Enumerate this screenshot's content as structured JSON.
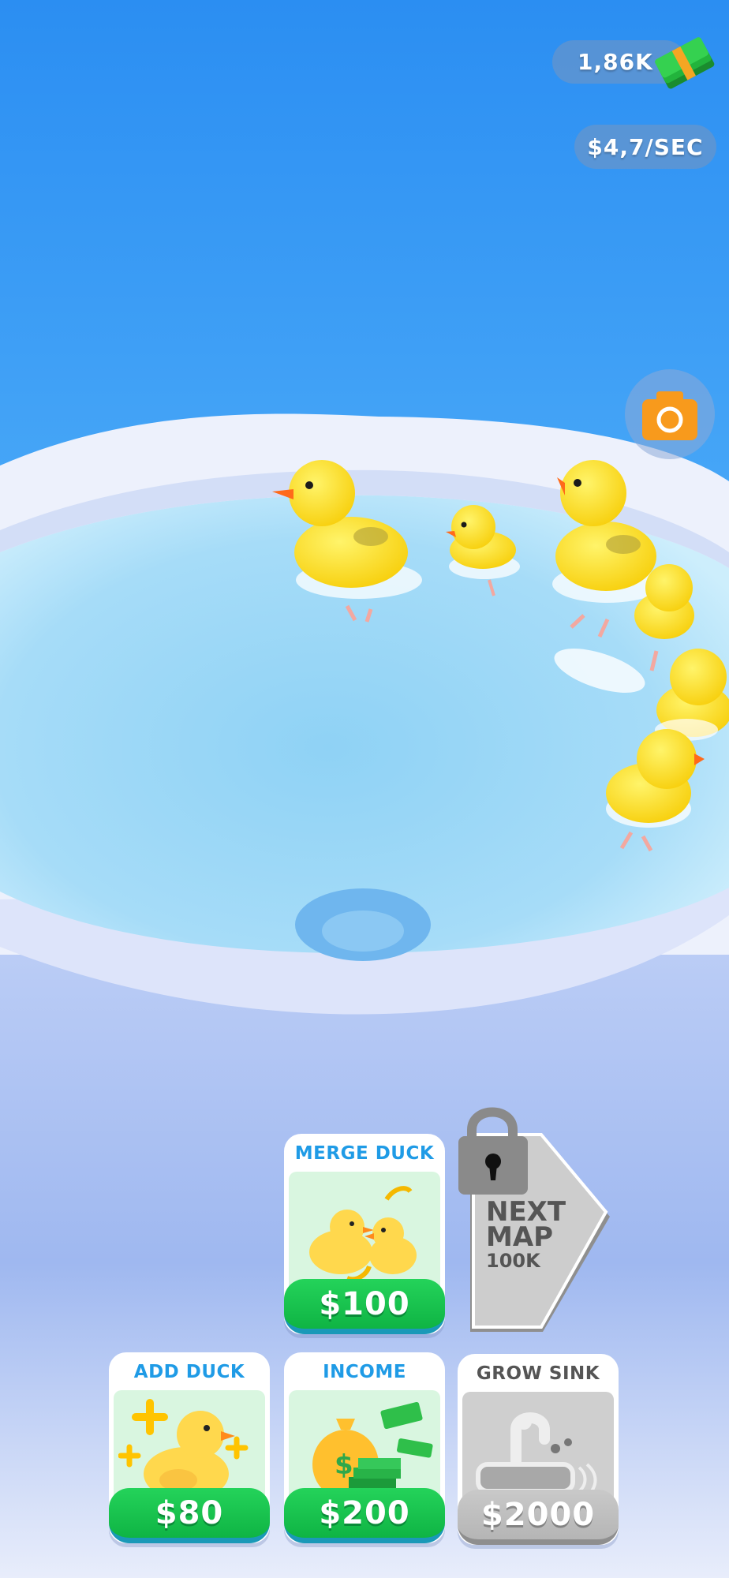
{
  "hud": {
    "money": "1,86K",
    "income_rate": "$4,7/SEC",
    "money_icon": "cash-stack-icon",
    "camera_icon": "camera-icon"
  },
  "upgrades": {
    "merge_duck": {
      "title": "MERGE DUCK",
      "price": "$100"
    },
    "add_duck": {
      "title": "ADD DUCK",
      "price": "$80"
    },
    "income": {
      "title": "INCOME",
      "price": "$200"
    },
    "grow_sink": {
      "title": "GROW SINK",
      "price": "$2000"
    }
  },
  "next_map": {
    "line1": "NEXT",
    "line2": "MAP",
    "cost": "100K",
    "icon": "padlock-icon"
  },
  "colors": {
    "sky": "#2f93f2",
    "water": "#a9ddf8",
    "green_button": "#16c24d",
    "title_blue": "#1f9be6",
    "locked_grey": "#c4c4c4"
  }
}
